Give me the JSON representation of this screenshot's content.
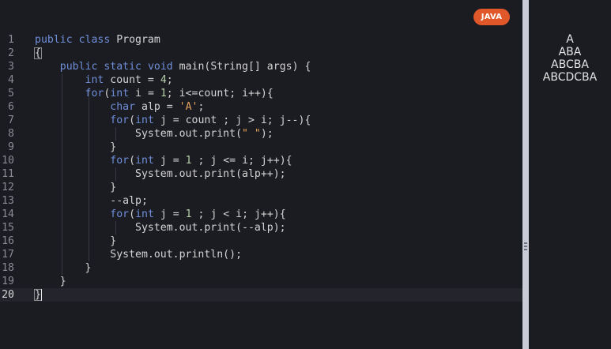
{
  "editor": {
    "language_badge": "JAVA",
    "lines": [
      {
        "n": "1",
        "tokens": [
          [
            "kw",
            "public"
          ],
          [
            "t",
            " "
          ],
          [
            "kw",
            "class"
          ],
          [
            "t",
            " Program"
          ]
        ]
      },
      {
        "n": "2",
        "tokens": [
          [
            "t",
            "{"
          ]
        ]
      },
      {
        "n": "3",
        "tokens": [
          [
            "t",
            "    "
          ],
          [
            "kw",
            "public"
          ],
          [
            "t",
            " "
          ],
          [
            "kw",
            "static"
          ],
          [
            "t",
            " "
          ],
          [
            "kw",
            "void"
          ],
          [
            "t",
            " main(String[] args) {"
          ]
        ]
      },
      {
        "n": "4",
        "tokens": [
          [
            "t",
            "        "
          ],
          [
            "kw",
            "int"
          ],
          [
            "t",
            " count = "
          ],
          [
            "num",
            "4"
          ],
          [
            "t",
            ";"
          ]
        ]
      },
      {
        "n": "5",
        "tokens": [
          [
            "t",
            "        "
          ],
          [
            "kw",
            "for"
          ],
          [
            "t",
            "("
          ],
          [
            "kw",
            "int"
          ],
          [
            "t",
            " i = "
          ],
          [
            "num",
            "1"
          ],
          [
            "t",
            "; i<=count; i++){"
          ]
        ]
      },
      {
        "n": "6",
        "tokens": [
          [
            "t",
            "            "
          ],
          [
            "kw",
            "char"
          ],
          [
            "t",
            " alp = "
          ],
          [
            "str",
            "'A'"
          ],
          [
            "t",
            ";"
          ]
        ]
      },
      {
        "n": "7",
        "tokens": [
          [
            "t",
            "            "
          ],
          [
            "kw",
            "for"
          ],
          [
            "t",
            "("
          ],
          [
            "kw",
            "int"
          ],
          [
            "t",
            " j = count ; j > i; j--){"
          ]
        ]
      },
      {
        "n": "8",
        "tokens": [
          [
            "t",
            "                System.out.print("
          ],
          [
            "str",
            "\" \""
          ],
          [
            "t",
            ");"
          ]
        ]
      },
      {
        "n": "9",
        "tokens": [
          [
            "t",
            "            }"
          ]
        ]
      },
      {
        "n": "10",
        "tokens": [
          [
            "t",
            "            "
          ],
          [
            "kw",
            "for"
          ],
          [
            "t",
            "("
          ],
          [
            "kw",
            "int"
          ],
          [
            "t",
            " j = "
          ],
          [
            "num",
            "1"
          ],
          [
            "t",
            " ; j <= i; j++){"
          ]
        ]
      },
      {
        "n": "11",
        "tokens": [
          [
            "t",
            "                System.out.print(alp++);"
          ]
        ]
      },
      {
        "n": "12",
        "tokens": [
          [
            "t",
            "            }"
          ]
        ]
      },
      {
        "n": "13",
        "tokens": [
          [
            "t",
            "            --alp;"
          ]
        ]
      },
      {
        "n": "14",
        "tokens": [
          [
            "t",
            "            "
          ],
          [
            "kw",
            "for"
          ],
          [
            "t",
            "("
          ],
          [
            "kw",
            "int"
          ],
          [
            "t",
            " j = "
          ],
          [
            "num",
            "1"
          ],
          [
            "t",
            " ; j < i; j++){"
          ]
        ]
      },
      {
        "n": "15",
        "tokens": [
          [
            "t",
            "                System.out.print(--alp);"
          ]
        ]
      },
      {
        "n": "16",
        "tokens": [
          [
            "t",
            "            }"
          ]
        ]
      },
      {
        "n": "17",
        "tokens": [
          [
            "t",
            "            System.out.println();"
          ]
        ]
      },
      {
        "n": "18",
        "tokens": [
          [
            "t",
            "        }"
          ]
        ]
      },
      {
        "n": "19",
        "tokens": [
          [
            "t",
            "    }"
          ]
        ]
      },
      {
        "n": "20",
        "tokens": [
          [
            "t",
            "}"
          ]
        ]
      }
    ],
    "active_line": "20"
  },
  "output": {
    "lines": [
      "A",
      "ABA",
      "ABCBA",
      "ABCDCBA"
    ]
  },
  "colors": {
    "background": "#1b1b22",
    "keyword": "#6f8fd8",
    "string": "#e2a35a",
    "number": "#b5cea8",
    "text": "#d4d4d4",
    "badge": "#e0582a",
    "divider": "#c9ccd6"
  }
}
